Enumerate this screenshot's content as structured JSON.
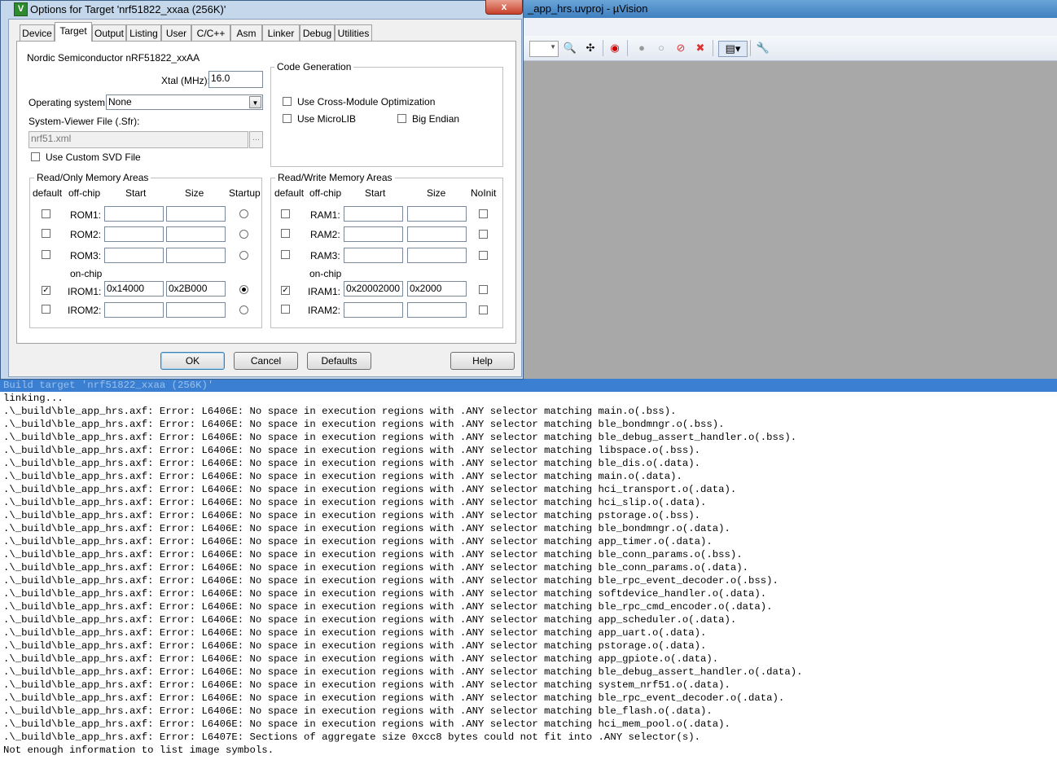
{
  "ide": {
    "title": "_app_hrs.uvproj - µVision"
  },
  "dialog": {
    "title": "Options for Target 'nrf51822_xxaa (256K)'",
    "close_label": "x",
    "tabs": [
      "Device",
      "Target",
      "Output",
      "Listing",
      "User",
      "C/C++",
      "Asm",
      "Linker",
      "Debug",
      "Utilities"
    ],
    "active_tab": "Target",
    "device_name": "Nordic Semiconductor nRF51822_xxAA",
    "xtal_label": "Xtal (MHz):",
    "xtal_value": "16.0",
    "os_label": "Operating system:",
    "os_value": "None",
    "svd_label": "System-Viewer File (.Sfr):",
    "svd_value": "nrf51.xml",
    "svd_browse": "...",
    "custom_svd_label": "Use Custom SVD File",
    "code_gen": {
      "title": "Code Generation",
      "cross_module": "Use Cross-Module Optimization",
      "microlib": "Use MicroLIB",
      "big_endian": "Big Endian"
    },
    "rom": {
      "title": "Read/Only Memory Areas",
      "headers": [
        "default",
        "off-chip",
        "Start",
        "Size",
        "Startup"
      ],
      "onchip_label": "on-chip",
      "rows": [
        {
          "name": "ROM1:",
          "default": false,
          "start": "",
          "size": "",
          "startup": false
        },
        {
          "name": "ROM2:",
          "default": false,
          "start": "",
          "size": "",
          "startup": false
        },
        {
          "name": "ROM3:",
          "default": false,
          "start": "",
          "size": "",
          "startup": false
        },
        {
          "name": "IROM1:",
          "default": true,
          "start": "0x14000",
          "size": "0x2B000",
          "startup": true
        },
        {
          "name": "IROM2:",
          "default": false,
          "start": "",
          "size": "",
          "startup": false
        }
      ]
    },
    "ram": {
      "title": "Read/Write Memory Areas",
      "headers": [
        "default",
        "off-chip",
        "Start",
        "Size",
        "NoInit"
      ],
      "onchip_label": "on-chip",
      "rows": [
        {
          "name": "RAM1:",
          "default": false,
          "start": "",
          "size": "",
          "noinit": false
        },
        {
          "name": "RAM2:",
          "default": false,
          "start": "",
          "size": "",
          "noinit": false
        },
        {
          "name": "RAM3:",
          "default": false,
          "start": "",
          "size": "",
          "noinit": false
        },
        {
          "name": "IRAM1:",
          "default": true,
          "start": "0x20002000",
          "size": "0x2000",
          "noinit": false
        },
        {
          "name": "IRAM2:",
          "default": false,
          "start": "",
          "size": "",
          "noinit": false
        }
      ]
    },
    "buttons": {
      "ok": "OK",
      "cancel": "Cancel",
      "defaults": "Defaults",
      "help": "Help"
    }
  },
  "build_output": [
    "Build target 'nrf51822_xxaa (256K)'",
    "linking...",
    ".\\_build\\ble_app_hrs.axf: Error: L6406E: No space in execution regions with .ANY selector matching main.o(.bss).",
    ".\\_build\\ble_app_hrs.axf: Error: L6406E: No space in execution regions with .ANY selector matching ble_bondmngr.o(.bss).",
    ".\\_build\\ble_app_hrs.axf: Error: L6406E: No space in execution regions with .ANY selector matching ble_debug_assert_handler.o(.bss).",
    ".\\_build\\ble_app_hrs.axf: Error: L6406E: No space in execution regions with .ANY selector matching libspace.o(.bss).",
    ".\\_build\\ble_app_hrs.axf: Error: L6406E: No space in execution regions with .ANY selector matching ble_dis.o(.data).",
    ".\\_build\\ble_app_hrs.axf: Error: L6406E: No space in execution regions with .ANY selector matching main.o(.data).",
    ".\\_build\\ble_app_hrs.axf: Error: L6406E: No space in execution regions with .ANY selector matching hci_transport.o(.data).",
    ".\\_build\\ble_app_hrs.axf: Error: L6406E: No space in execution regions with .ANY selector matching hci_slip.o(.data).",
    ".\\_build\\ble_app_hrs.axf: Error: L6406E: No space in execution regions with .ANY selector matching pstorage.o(.bss).",
    ".\\_build\\ble_app_hrs.axf: Error: L6406E: No space in execution regions with .ANY selector matching ble_bondmngr.o(.data).",
    ".\\_build\\ble_app_hrs.axf: Error: L6406E: No space in execution regions with .ANY selector matching app_timer.o(.data).",
    ".\\_build\\ble_app_hrs.axf: Error: L6406E: No space in execution regions with .ANY selector matching ble_conn_params.o(.bss).",
    ".\\_build\\ble_app_hrs.axf: Error: L6406E: No space in execution regions with .ANY selector matching ble_conn_params.o(.data).",
    ".\\_build\\ble_app_hrs.axf: Error: L6406E: No space in execution regions with .ANY selector matching ble_rpc_event_decoder.o(.bss).",
    ".\\_build\\ble_app_hrs.axf: Error: L6406E: No space in execution regions with .ANY selector matching softdevice_handler.o(.data).",
    ".\\_build\\ble_app_hrs.axf: Error: L6406E: No space in execution regions with .ANY selector matching ble_rpc_cmd_encoder.o(.data).",
    ".\\_build\\ble_app_hrs.axf: Error: L6406E: No space in execution regions with .ANY selector matching app_scheduler.o(.data).",
    ".\\_build\\ble_app_hrs.axf: Error: L6406E: No space in execution regions with .ANY selector matching app_uart.o(.data).",
    ".\\_build\\ble_app_hrs.axf: Error: L6406E: No space in execution regions with .ANY selector matching pstorage.o(.data).",
    ".\\_build\\ble_app_hrs.axf: Error: L6406E: No space in execution regions with .ANY selector matching app_gpiote.o(.data).",
    ".\\_build\\ble_app_hrs.axf: Error: L6406E: No space in execution regions with .ANY selector matching ble_debug_assert_handler.o(.data).",
    ".\\_build\\ble_app_hrs.axf: Error: L6406E: No space in execution regions with .ANY selector matching system_nrf51.o(.data).",
    ".\\_build\\ble_app_hrs.axf: Error: L6406E: No space in execution regions with .ANY selector matching ble_rpc_event_decoder.o(.data).",
    ".\\_build\\ble_app_hrs.axf: Error: L6406E: No space in execution regions with .ANY selector matching ble_flash.o(.data).",
    ".\\_build\\ble_app_hrs.axf: Error: L6406E: No space in execution regions with .ANY selector matching hci_mem_pool.o(.data).",
    ".\\_build\\ble_app_hrs.axf: Error: L6407E: Sections of aggregate size 0xcc8 bytes could not fit into .ANY selector(s).",
    "Not enough information to list image symbols."
  ]
}
